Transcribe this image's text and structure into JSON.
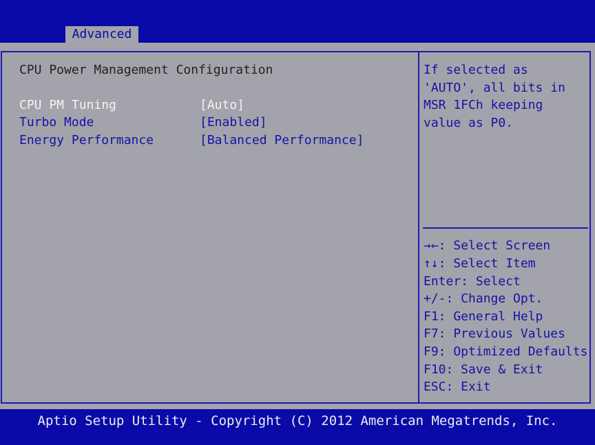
{
  "header": {
    "active_tab": "Advanced"
  },
  "main": {
    "section_title": "CPU Power Management Configuration",
    "settings": [
      {
        "label": "CPU PM Tuning",
        "value": "[Auto]"
      },
      {
        "label": "Turbo Mode",
        "value": "[Enabled]"
      },
      {
        "label": "Energy Performance",
        "value": "[Balanced Performance]"
      }
    ]
  },
  "help": {
    "lines": [
      "If selected as",
      "'AUTO', all bits in",
      "MSR 1FCh keeping",
      "value as P0."
    ]
  },
  "keys": {
    "lines": [
      "→←: Select Screen",
      "↑↓: Select Item",
      "Enter: Select",
      "+/-: Change Opt.",
      "F1: General Help",
      "F7: Previous Values",
      "F9: Optimized Defaults",
      "F10: Save & Exit",
      "ESC: Exit"
    ]
  },
  "footer": {
    "text": "Aptio Setup Utility - Copyright (C) 2012 American Megatrends, Inc."
  },
  "colors": {
    "bar_blue": "#0a0aa8",
    "panel_gray": "#a3a3ab",
    "highlight_white": "#f4f4f4",
    "text_blue": "#1414a6"
  }
}
